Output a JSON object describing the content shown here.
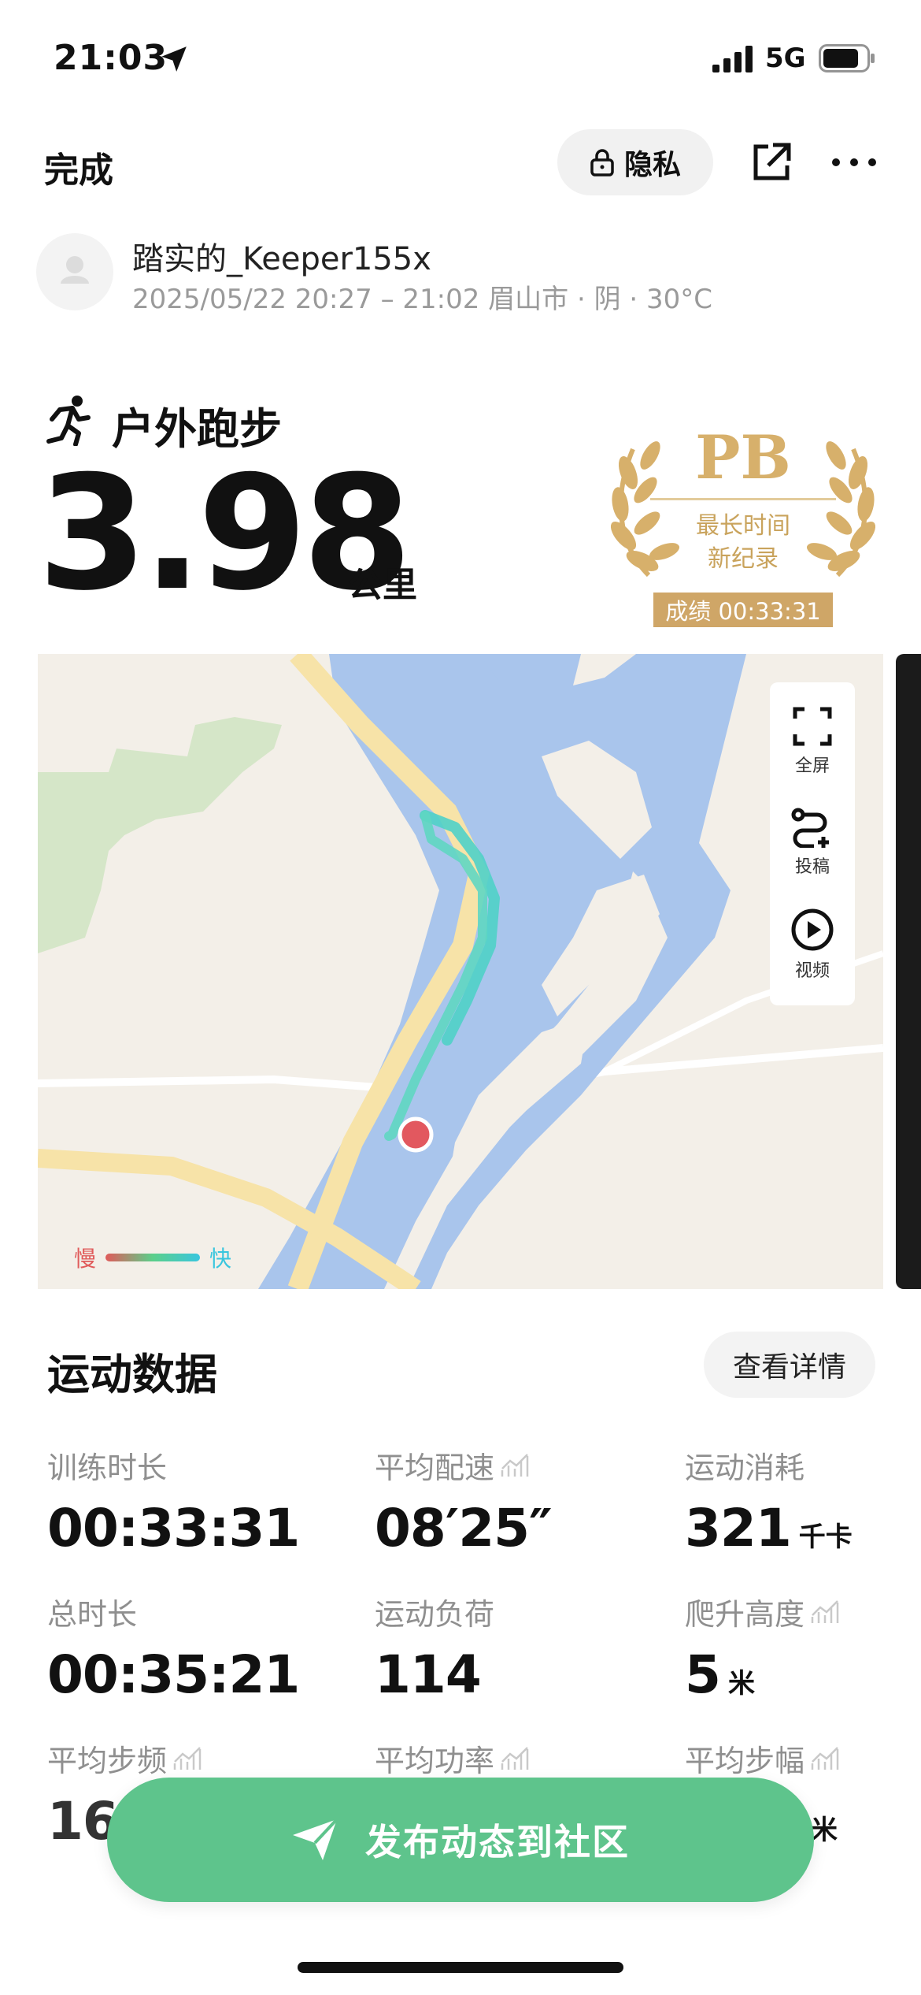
{
  "status_bar": {
    "time": "21:03",
    "network": "5G"
  },
  "header": {
    "done_label": "完成",
    "privacy_label": "隐私"
  },
  "user": {
    "name": "踏实的_Keeper155x",
    "subline": "2025/05/22 20:27 – 21:02 眉山市 · 阴 · 30°C"
  },
  "activity": {
    "title": "户外跑步",
    "distance": "3.98",
    "unit": "公里"
  },
  "pb_badge": {
    "title": "PB",
    "line1": "最长时间",
    "line2": "新纪录",
    "score": "成绩 00:33:31"
  },
  "map": {
    "tools": [
      {
        "icon": "fullscreen-icon",
        "label": "全屏"
      },
      {
        "icon": "route-plus-icon",
        "label": "投稿"
      },
      {
        "icon": "play-icon",
        "label": "视频"
      }
    ],
    "legend": {
      "slow": "慢",
      "fast": "快"
    }
  },
  "data_section": {
    "title": "运动数据",
    "details_label": "查看详情",
    "metrics": [
      {
        "label": "训练时长",
        "value": "00:33:31",
        "unit": ""
      },
      {
        "label": "平均配速",
        "value": "08′25″",
        "unit": ""
      },
      {
        "label": "运动消耗",
        "value": "321",
        "unit": "千卡"
      },
      {
        "label": "总时长",
        "value": "00:35:21",
        "unit": ""
      },
      {
        "label": "运动负荷",
        "value": "114",
        "unit": ""
      },
      {
        "label": "爬升高度",
        "value": "5",
        "unit": "米"
      },
      {
        "label": "平均步频",
        "value": "161",
        "unit": ""
      },
      {
        "label": "平均功率",
        "value": "",
        "unit": ""
      },
      {
        "label": "平均步幅",
        "value": "",
        "unit": "米"
      }
    ]
  },
  "publish": {
    "label": "发布动态到社区"
  },
  "colors": {
    "accent_green": "#5ec48c",
    "pb_gold": "#cfa667",
    "water": "#a9c5ec",
    "route": "#4fd0c8"
  }
}
